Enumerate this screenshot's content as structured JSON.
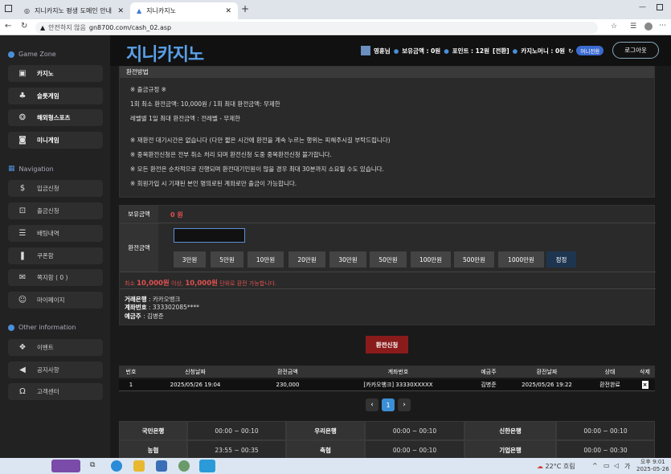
{
  "browser": {
    "tabs": [
      {
        "label": "지니카지노 평생 도메인 안내"
      },
      {
        "label": "지니카지노"
      }
    ],
    "new_tab": "+",
    "security": "안전하지 않음",
    "url": "gn8700.com/cash_02.asp"
  },
  "sidebar": {
    "game_zone_title": "Game Zone",
    "game_items": [
      {
        "label": "카지노",
        "icon": "card-icon"
      },
      {
        "label": "슬롯게임",
        "icon": "cherry-icon"
      },
      {
        "label": "해외형스포츠",
        "icon": "ball-icon"
      },
      {
        "label": "미니게임",
        "icon": "gamepad-icon"
      }
    ],
    "nav_title": "Navigation",
    "nav_items": [
      {
        "label": "입금신청",
        "icon": "deposit-icon"
      },
      {
        "label": "출금신청",
        "icon": "withdraw-icon"
      },
      {
        "label": "배팅내역",
        "icon": "list-icon"
      },
      {
        "label": "쿠폰함",
        "icon": "coupon-icon"
      },
      {
        "label": "쪽지함 ( 0 )",
        "icon": "mail-icon"
      },
      {
        "label": "마이페이지",
        "icon": "user-icon"
      }
    ],
    "other_title": "Other information",
    "other_items": [
      {
        "label": "이벤트",
        "icon": "gift-icon"
      },
      {
        "label": "공지사항",
        "icon": "megaphone-icon"
      },
      {
        "label": "고객센터",
        "icon": "headset-icon"
      }
    ]
  },
  "header": {
    "logo": "지니카지노",
    "username": "영훈님",
    "balance": "보유금액 : 0원",
    "points": "포인트 : 12원",
    "convert": "[전환]",
    "casino_money": "카지노머니 : 0원",
    "mini_convert": "머니전환",
    "logout": "로그아웃"
  },
  "rules": {
    "title": "환전방법",
    "lines": [
      "※ 출금규정 ※",
      "1회 최소 환전금액: 10,000원 / 1회 최대 환전금액: 무제한",
      "레벨별 1일 최대 환전금액 : 전레벨 - 무제한",
      "※ 재환전 대기시간은 없습니다 (다만 짧은 시간에 환전을 계속 누르는 행위는 피해주시길 부탁드립니다)",
      "※ 중복환전신청은 전부 취소 처리 되며 환전신청 도중 중복환전신청 불가합니다.",
      "※ 모든 환전은 순차적으로 진행되며 환전대기인원이 많을 경우 최대 30분까지 소요될 수도 있습니다.",
      "※ 회원가입 시 기재된 본인 명의로된 계좌로만 출금이 가능합니다."
    ]
  },
  "form": {
    "balance_label": "보유금액",
    "balance_value": "0 원",
    "amount_label": "환전금액",
    "amount_value": "",
    "amount_buttons": [
      "3만원",
      "5만원",
      "10만원",
      "20만원",
      "30만원",
      "50만원",
      "100만원",
      "500만원",
      "1000만원",
      "정정"
    ],
    "note_prefix": "최소",
    "note_min": "10,000원",
    "note_mid": "이상,",
    "note_unit": "10,000원",
    "note_suffix": "단위로 환전 가능합니다.",
    "bank_label": "거래은행",
    "bank_value": ": 카카오뱅크",
    "account_label": "계좌번호",
    "account_value": ": 333302085****",
    "holder_label": "예금주",
    "holder_value": ": 김병준"
  },
  "apply_button": "환전신청",
  "history": {
    "headers": [
      "번호",
      "신청날짜",
      "환전금액",
      "계좌번호",
      "예금주",
      "환전날짜",
      "상태",
      "삭제"
    ],
    "rows": [
      [
        "1",
        "2025/05/26 19:04",
        "230,000",
        "[카카오뱅크] 33330XXXXX",
        "김병준",
        "2025/05/26 19:22",
        "환전완료",
        "×"
      ]
    ]
  },
  "pagination": {
    "prev": "‹",
    "current": "1",
    "next": "›"
  },
  "bank_hours": [
    [
      {
        "name": "국민은행",
        "time": "00:00 ~ 00:10"
      },
      {
        "name": "우리은행",
        "time": "00:00 ~ 00:10"
      },
      {
        "name": "신한은행",
        "time": "00:00 ~ 00:10"
      }
    ],
    [
      {
        "name": "농협",
        "time": "23:55 ~ 00:35"
      },
      {
        "name": "축협",
        "time": "00:00 ~ 00:10"
      },
      {
        "name": "기업은행",
        "time": "00:00 ~ 00:30"
      }
    ]
  ],
  "taskbar": {
    "weather": "22°C 흐림",
    "time": "오후 9:01",
    "date": "2025-05-26",
    "lang": "가"
  }
}
